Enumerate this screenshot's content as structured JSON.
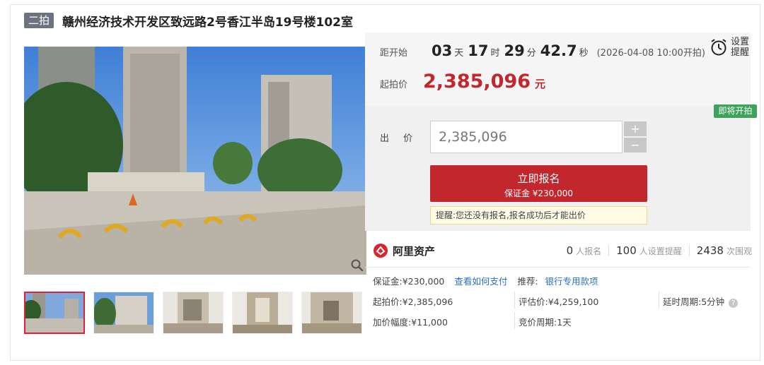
{
  "header": {
    "round_tag": "二拍",
    "title": "赣州经济技术开发区致远路2号香江半岛19号楼102室"
  },
  "gallery": {
    "main_alt": "香江半岛 小区入口",
    "thumbnails": [
      "小区入口",
      "楼栋外观",
      "室内毛坯",
      "室内毛坯",
      "室内毛坯"
    ],
    "selected_index": 0
  },
  "countdown": {
    "label": "距开始",
    "days": "03",
    "days_unit": "天",
    "hours": "17",
    "hours_unit": "时",
    "minutes": "29",
    "minutes_unit": "分",
    "seconds": "42.7",
    "seconds_unit": "秒",
    "start_text": "(2026-04-08 10:00开拍)"
  },
  "reminder": {
    "line1": "设置",
    "line2": "提醒"
  },
  "starting_price": {
    "label": "起拍价",
    "value": "2,385,096",
    "unit": "元"
  },
  "status_badge": "即将开拍",
  "bid": {
    "label": "出 价",
    "value": "2,385,096",
    "plus": "+",
    "minus": "−"
  },
  "signup_button": {
    "label": "立即报名",
    "deposit": "保证金 ¥230,000"
  },
  "tip": "提醒:您还没有报名,报名成功后才能出价",
  "brand": {
    "name": "阿里资产"
  },
  "stats": [
    {
      "num": "0",
      "label": "人报名"
    },
    {
      "num": "100",
      "label": "人设置提醒"
    },
    {
      "num": "2438",
      "label": "次围观"
    }
  ],
  "details": {
    "deposit": "保证金:¥230,000",
    "how_to_pay": "查看如何支付",
    "recommend_label": "推荐:",
    "recommend_link": "银行专用款项",
    "starting_price": "起拍价:¥2,385,096",
    "appraisal": "评估价:¥4,259,100",
    "delay_period": "延时周期:5分钟",
    "increment": "加价幅度:¥11,000",
    "bid_period": "竞价周期:1天",
    "help": "?"
  },
  "colors": {
    "accent_red": "#c1272d",
    "badge_green": "#3da35a",
    "link_blue": "#2a6fc9"
  }
}
